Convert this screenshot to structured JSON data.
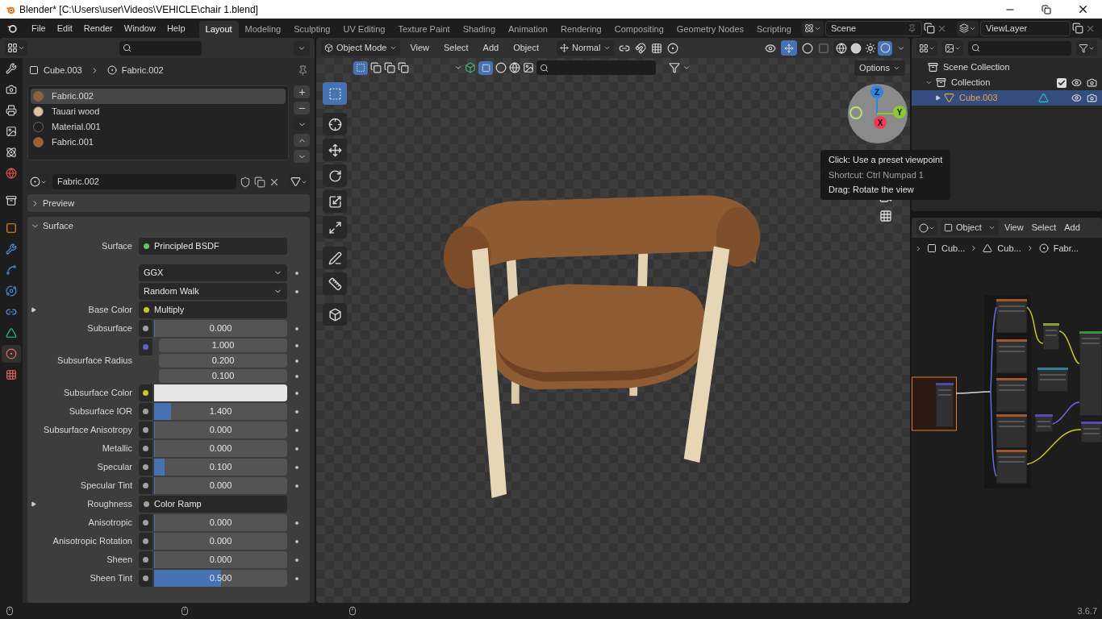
{
  "title_bar": {
    "title": "Blender* [C:\\Users\\user\\Videos\\VEHICLE\\chair 1.blend]"
  },
  "menu": [
    "File",
    "Edit",
    "Render",
    "Window",
    "Help"
  ],
  "workspaces": [
    {
      "label": "Layout",
      "selected": true
    },
    {
      "label": "Modeling",
      "selected": false
    },
    {
      "label": "Sculpting",
      "selected": false
    },
    {
      "label": "UV Editing",
      "selected": false
    },
    {
      "label": "Texture Paint",
      "selected": false
    },
    {
      "label": "Shading",
      "selected": false
    },
    {
      "label": "Animation",
      "selected": false
    },
    {
      "label": "Rendering",
      "selected": false
    },
    {
      "label": "Compositing",
      "selected": false
    },
    {
      "label": "Geometry Nodes",
      "selected": false
    },
    {
      "label": "Scripting",
      "selected": false
    }
  ],
  "scene": "Scene",
  "view_layer": "ViewLayer",
  "properties": {
    "tabs": [
      {
        "kind": "tool",
        "selected": false
      },
      {
        "kind": "render",
        "selected": false
      },
      {
        "kind": "output",
        "selected": false
      },
      {
        "kind": "view_layer",
        "selected": false
      },
      {
        "kind": "scene",
        "selected": false
      },
      {
        "kind": "world",
        "selected": false
      },
      {
        "kind": "collection",
        "selected": false
      },
      {
        "kind": "object",
        "selected": false
      },
      {
        "kind": "modifiers",
        "selected": false
      },
      {
        "kind": "particles",
        "selected": false
      },
      {
        "kind": "physics",
        "selected": false
      },
      {
        "kind": "constraints",
        "selected": false
      },
      {
        "kind": "data",
        "selected": false
      },
      {
        "kind": "material",
        "selected": true
      },
      {
        "kind": "texture",
        "selected": false
      }
    ],
    "breadcrumb": [
      "Cube.003",
      "Fabric.002"
    ],
    "slots": [
      {
        "name": "Fabric.002",
        "selected": true,
        "color": "#9a5f30"
      },
      {
        "name": "Tauari wood",
        "selected": false,
        "color": "#d9c3a0"
      },
      {
        "name": "Material.001",
        "selected": false,
        "color": "#202020"
      },
      {
        "name": "Fabric.001",
        "selected": false,
        "color": "#a0602c"
      }
    ],
    "material": "Fabric.002",
    "panels": [
      {
        "title": "Preview",
        "expanded": false
      },
      {
        "title": "Surface",
        "expanded": true
      }
    ],
    "rows": [
      {
        "kind": "link",
        "label": "Surface",
        "value": "Principled BSDF",
        "socket": {
          "color": "#63c763"
        }
      },
      {
        "kind": "dropdown",
        "value": "GGX"
      },
      {
        "kind": "dropdown",
        "value": "Random Walk"
      },
      {
        "kind": "link",
        "label": "Base Color",
        "value": "Multiply",
        "socket": {
          "color": "#c7c729"
        },
        "expanded": false
      },
      {
        "kind": "slider",
        "label": "Subsurface",
        "value": "0.000",
        "level": 0,
        "socket": {
          "color": "#a1a1a1"
        }
      },
      {
        "kind": "vector",
        "label": "Subsurface Radius",
        "values": [
          "1.000",
          "0.200",
          "0.100"
        ],
        "socket": {
          "color": "#6363c7"
        }
      },
      {
        "kind": "swatch",
        "label": "Subsurface Color",
        "color": "#e6e6e6",
        "socket": {
          "color": "#c7c729"
        }
      },
      {
        "kind": "slider",
        "label": "Subsurface IOR",
        "value": "1.400",
        "level": 0.13,
        "socket": {
          "color": "#a1a1a1"
        }
      },
      {
        "kind": "slider",
        "label": "Subsurface Anisotropy",
        "value": "0.000",
        "level": 0,
        "socket": {
          "color": "#a1a1a1"
        }
      },
      {
        "kind": "slider",
        "label": "Metallic",
        "value": "0.000",
        "level": 0,
        "socket": {
          "color": "#a1a1a1"
        }
      },
      {
        "kind": "slider",
        "label": "Specular",
        "value": "0.100",
        "level": 0.08,
        "socket": {
          "color": "#a1a1a1"
        }
      },
      {
        "kind": "slider",
        "label": "Specular Tint",
        "value": "0.000",
        "level": 0,
        "socket": {
          "color": "#a1a1a1"
        }
      },
      {
        "kind": "link",
        "label": "Roughness",
        "value": "Color Ramp",
        "socket": {
          "color": "#a1a1a1"
        },
        "expanded": false
      },
      {
        "kind": "slider",
        "label": "Anisotropic",
        "value": "0.000",
        "level": 0,
        "socket": {
          "color": "#a1a1a1"
        }
      },
      {
        "kind": "slider",
        "label": "Anisotropic Rotation",
        "value": "0.000",
        "level": 0,
        "socket": {
          "color": "#a1a1a1"
        }
      },
      {
        "kind": "slider",
        "label": "Sheen",
        "value": "0.000",
        "level": 0,
        "socket": {
          "color": "#a1a1a1"
        }
      },
      {
        "kind": "slider",
        "label": "Sheen Tint",
        "value": "0.500",
        "level": 0.5,
        "socket": {
          "color": "#a1a1a1"
        }
      }
    ]
  },
  "viewport": {
    "mode": "Object Mode",
    "menu": [
      "View",
      "Select",
      "Add",
      "Object"
    ],
    "orientation": "Normal",
    "options": "Options",
    "tools": [
      {
        "kind": "select",
        "selected": true
      },
      {
        "kind": "cursor",
        "selected": false
      },
      {
        "kind": "move",
        "selected": false
      },
      {
        "kind": "rotate",
        "selected": false
      },
      {
        "kind": "scale",
        "selected": false
      },
      {
        "kind": "transform",
        "selected": false
      },
      {
        "kind": "annotate",
        "selected": false
      },
      {
        "kind": "measure",
        "selected": false
      },
      {
        "kind": "add_cube",
        "selected": false
      }
    ],
    "axes": [
      {
        "label": "Z",
        "color": "#2f83e3"
      },
      {
        "label": "Y",
        "color": "#8bc92f"
      },
      {
        "label": "X",
        "color": "#f03a55"
      }
    ],
    "tooltip": [
      {
        "text": "Click: Use a preset viewpoint",
        "kind": "action"
      },
      {
        "text": "Shortcut: Ctrl Numpad 1",
        "kind": "shortcut"
      },
      {
        "text": "Drag: Rotate the view",
        "kind": "action"
      }
    ]
  },
  "outliner": {
    "tree": [
      {
        "label": "Scene Collection",
        "kind": "scene",
        "selected": false,
        "children": [
          {
            "label": "Collection",
            "kind": "collection",
            "selected": false,
            "expanded": true,
            "checked": true,
            "children": [
              {
                "label": "Cube.003",
                "kind": "object",
                "selected": true,
                "expanded": false
              }
            ]
          }
        ]
      }
    ]
  },
  "node_editor": {
    "mode": "Object",
    "menu": [
      "View",
      "Select",
      "Add"
    ],
    "breadcrumb": [
      "Cub...",
      "Cub...",
      "Fabr..."
    ]
  },
  "status_bar": {
    "version": "3.6.7"
  }
}
